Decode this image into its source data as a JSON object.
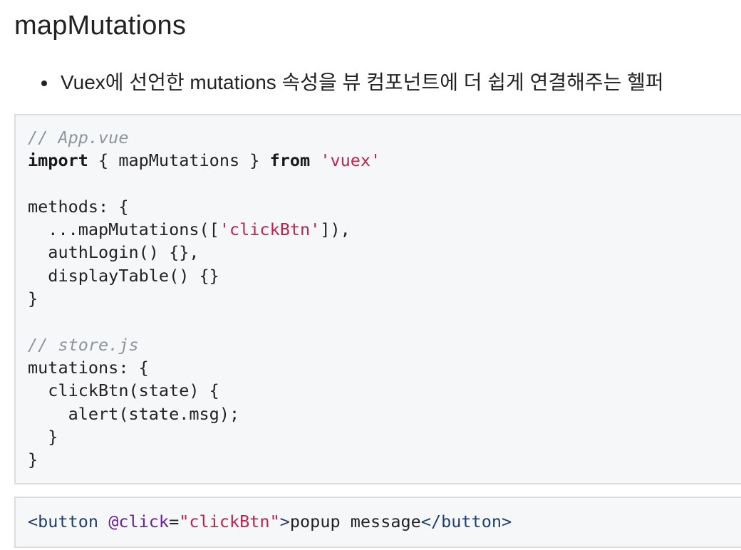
{
  "title": "mapMutations",
  "bullet": {
    "text": "Vuex에 선언한 mutations 속성을 뷰 컴포넌트에 더 쉽게 연결해주는 헬퍼"
  },
  "code_main": {
    "lines": [
      [
        {
          "t": "// App.vue",
          "c": "comment"
        }
      ],
      [
        {
          "t": "import",
          "c": "keyword"
        },
        {
          "t": " { mapMutations } ",
          "c": "plain"
        },
        {
          "t": "from",
          "c": "keyword"
        },
        {
          "t": " ",
          "c": "plain"
        },
        {
          "t": "'vuex'",
          "c": "string"
        }
      ],
      [],
      [
        {
          "t": "methods: {",
          "c": "plain"
        }
      ],
      [
        {
          "t": "  ...mapMutations([",
          "c": "plain"
        },
        {
          "t": "'clickBtn'",
          "c": "string"
        },
        {
          "t": "]),",
          "c": "plain"
        }
      ],
      [
        {
          "t": "  authLogin() {},",
          "c": "plain"
        }
      ],
      [
        {
          "t": "  displayTable() {}",
          "c": "plain"
        }
      ],
      [
        {
          "t": "}",
          "c": "plain"
        }
      ],
      [],
      [
        {
          "t": "// store.js",
          "c": "comment"
        }
      ],
      [
        {
          "t": "mutations: {",
          "c": "plain"
        }
      ],
      [
        {
          "t": "  clickBtn(state) {",
          "c": "plain"
        }
      ],
      [
        {
          "t": "    alert(state.msg);",
          "c": "plain"
        }
      ],
      [
        {
          "t": "  }",
          "c": "plain"
        }
      ],
      [
        {
          "t": "}",
          "c": "plain"
        }
      ]
    ]
  },
  "code_button": {
    "lines": [
      [
        {
          "t": "<button ",
          "c": "tag"
        },
        {
          "t": "@click",
          "c": "attr"
        },
        {
          "t": "=",
          "c": "plain"
        },
        {
          "t": "\"clickBtn\"",
          "c": "string"
        },
        {
          "t": ">",
          "c": "tag"
        },
        {
          "t": "popup message",
          "c": "plain"
        },
        {
          "t": "</button>",
          "c": "tag"
        }
      ]
    ]
  },
  "colors": {
    "comment": "#8e959c",
    "string": "#c0244a",
    "tag": "#1f3f73",
    "attr": "#6a1fa0",
    "code_bg": "#f6f7f9",
    "code_border": "#dcdde1"
  }
}
